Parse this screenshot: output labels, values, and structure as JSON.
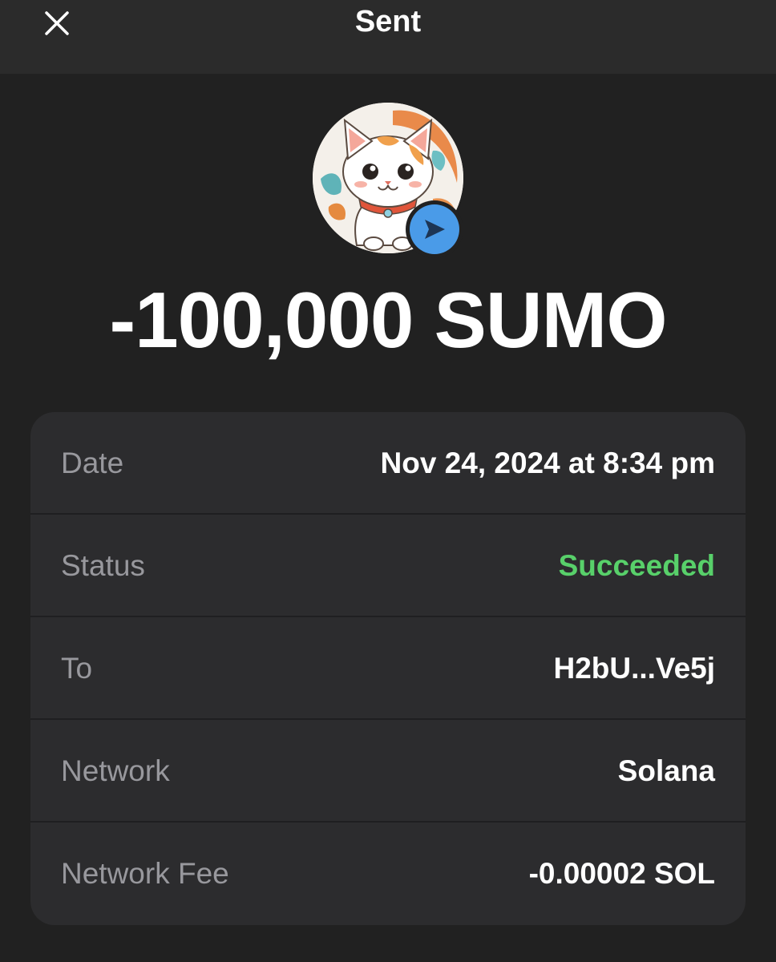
{
  "header": {
    "title": "Sent",
    "close_icon": "close-icon"
  },
  "token": {
    "avatar_icon": "cat-token-logo",
    "badge_icon": "send-arrow-icon",
    "badge_color": "#4a9be8"
  },
  "amount": "-100,000 SUMO",
  "details": {
    "date": {
      "label": "Date",
      "value": "Nov 24, 2024 at 8:34 pm"
    },
    "status": {
      "label": "Status",
      "value": "Succeeded",
      "color": "#58d06a"
    },
    "to": {
      "label": "To",
      "value": "H2bU...Ve5j"
    },
    "network": {
      "label": "Network",
      "value": "Solana"
    },
    "fee": {
      "label": "Network Fee",
      "value": "-0.00002 SOL"
    }
  },
  "colors": {
    "background": "#212121",
    "header": "#2b2b2b",
    "card": "#2c2c2e",
    "label": "#98989d"
  }
}
